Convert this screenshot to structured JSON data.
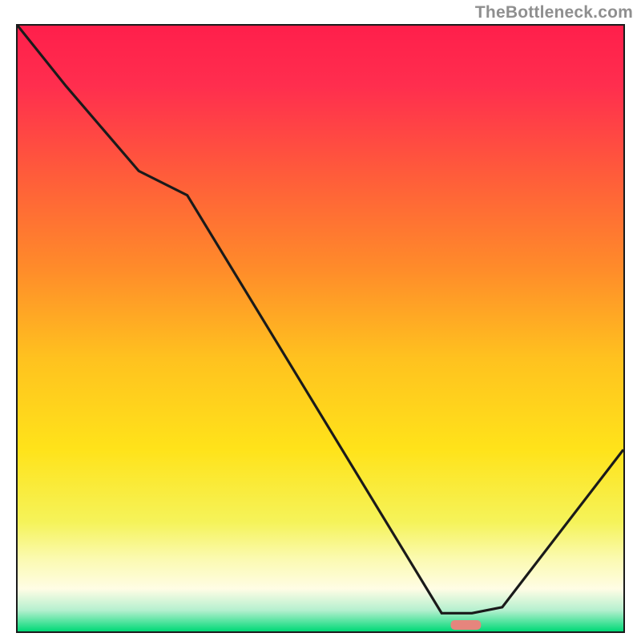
{
  "attribution": "TheBottleneck.com",
  "chart_data": {
    "type": "line",
    "title": "",
    "xlabel": "",
    "ylabel": "",
    "xlim": [
      0,
      100
    ],
    "ylim": [
      0,
      100
    ],
    "series": [
      {
        "name": "bottleneck-curve",
        "x": [
          0,
          8,
          20,
          28,
          70,
          75,
          80,
          100
        ],
        "y": [
          100,
          90,
          76,
          72,
          3,
          3,
          4,
          30
        ]
      }
    ],
    "gradient_stops": [
      {
        "offset": 0.0,
        "color": "#ff1f4b"
      },
      {
        "offset": 0.1,
        "color": "#ff2e4e"
      },
      {
        "offset": 0.25,
        "color": "#ff5d3a"
      },
      {
        "offset": 0.4,
        "color": "#ff8b2a"
      },
      {
        "offset": 0.55,
        "color": "#ffc21f"
      },
      {
        "offset": 0.7,
        "color": "#ffe31a"
      },
      {
        "offset": 0.82,
        "color": "#f5f35a"
      },
      {
        "offset": 0.88,
        "color": "#fbfab0"
      },
      {
        "offset": 0.93,
        "color": "#fffde5"
      },
      {
        "offset": 0.965,
        "color": "#b5f0cf"
      },
      {
        "offset": 1.0,
        "color": "#00d977"
      }
    ],
    "optimal_marker": {
      "x_center": 74,
      "width": 5,
      "color": "#e6857d"
    }
  },
  "colors": {
    "axis": "#1a1a1a",
    "curve": "#1a1a1a",
    "attribution": "#8f8f8f"
  }
}
